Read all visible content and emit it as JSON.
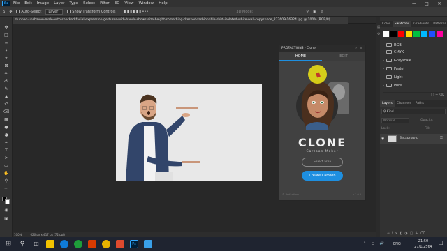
{
  "menu": [
    "File",
    "Edit",
    "Image",
    "Layer",
    "Type",
    "Select",
    "Filter",
    "3D",
    "View",
    "Window",
    "Help"
  ],
  "app_logo": "Ps",
  "options": {
    "auto_select": "Auto-Select",
    "layer_dropdown": "Layer",
    "show_transform": "Show Transform Controls",
    "mode_3d": "3D Mode:"
  },
  "document_tab": "stunned-unshaven-male-with-shocked-facial-expression-gestures-with-hands-shows-size-height-something-dressed-fashionable-shirt-isolated-white-wall-copyspace_273609-16324.jpg @ 100% (RGB/8)",
  "status": {
    "zoom": "100%",
    "doc_size": "626 px x 417 px (72 ppi)"
  },
  "right_panel": {
    "top_tabs": [
      "Color",
      "Swatches",
      "Gradients",
      "Patterns"
    ],
    "active_top_tab": "Swatches",
    "swatch_colors": [
      "#ffffff",
      "#000000",
      "#ff0000",
      "#ffd800",
      "#00c040",
      "#00b8ff",
      "#2050ff",
      "#ff00a0"
    ],
    "swatch_groups": [
      "RGB",
      "CMYK",
      "Grayscale",
      "Pastel",
      "Light",
      "Pure"
    ],
    "layer_tabs": [
      "Layers",
      "Channels",
      "Paths"
    ],
    "kind_filter": "Kind",
    "blend_mode": "Normal",
    "opacity_label": "Opacity:",
    "lock_label": "Lock:",
    "fill_label": "Fill:",
    "layer_name": "Background"
  },
  "clone_panel": {
    "header": "PROFACTIONS - Clone",
    "tabs": [
      "HOME",
      "EDIT"
    ],
    "active_tab": "HOME",
    "brand": "CLONE",
    "tagline": "Cartoon Maker",
    "select_area": "Select area",
    "create_button": "Create Cartoon",
    "footer_left": "© ProfActions",
    "footer_right": "v 1.0.2"
  },
  "taskbar": {
    "language": "ENG",
    "time": "21:50",
    "date": "27/1/2564"
  }
}
